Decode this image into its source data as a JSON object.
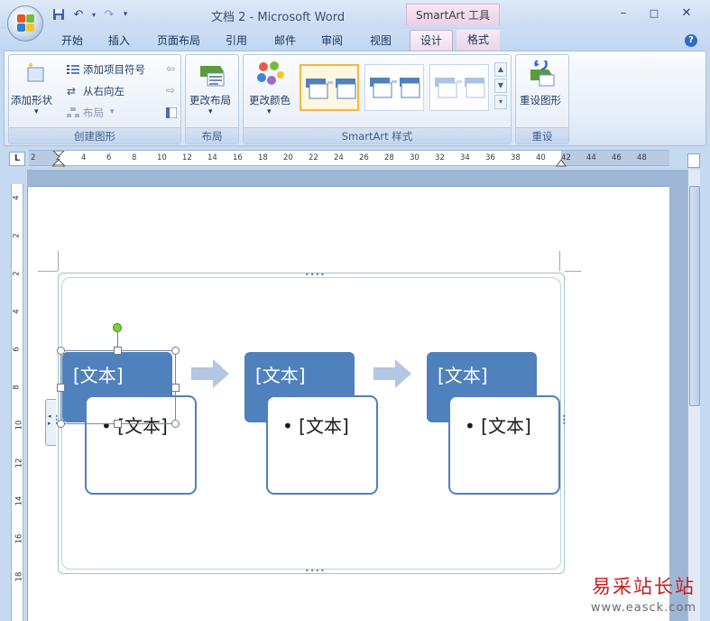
{
  "window": {
    "title": "文档 2 - Microsoft Word",
    "context_tools": "SmartArt 工具",
    "minimize": "–",
    "maximize": "□",
    "close": "✕"
  },
  "quick_access": {
    "save_icon": "save-icon",
    "undo_icon": "undo-icon",
    "redo_icon": "redo-icon",
    "customize_icon": "dropdown-icon"
  },
  "tabs": [
    "开始",
    "插入",
    "页面布局",
    "引用",
    "邮件",
    "审阅",
    "视图",
    "设计",
    "格式"
  ],
  "active_tab": "设计",
  "ribbon": {
    "create_graphic": {
      "label": "创建图形",
      "add_shape": "添加形状",
      "add_bullet": "添加项目符号",
      "right_to_left": "从右向左",
      "layout": "布局"
    },
    "layouts": {
      "label": "布局",
      "change_layout": "更改布局"
    },
    "smartart_styles": {
      "label": "SmartArt 样式",
      "change_colors": "更改颜色"
    },
    "reset": {
      "label": "重设",
      "reset_graphic": "重设图形"
    }
  },
  "ruler": {
    "corner": "L",
    "h_numbers": [
      "2",
      "2",
      "4",
      "6",
      "8",
      "10",
      "12",
      "14",
      "16",
      "18",
      "20",
      "22",
      "24",
      "26",
      "28",
      "30",
      "32",
      "34",
      "36",
      "38",
      "40",
      "42",
      "44",
      "46",
      "48"
    ],
    "v_numbers": [
      "4",
      "2",
      "2",
      "4",
      "6",
      "8",
      "10",
      "12",
      "14",
      "16",
      "18"
    ]
  },
  "smartart": {
    "nodes": [
      {
        "title": "[文本]",
        "bullet": "• [文本]"
      },
      {
        "title": "[文本]",
        "bullet": "• [文本]"
      },
      {
        "title": "[文本]",
        "bullet": "• [文本]"
      }
    ],
    "colors": {
      "accent": "#4f81bd",
      "arrow": "#b3c7e2",
      "rotate_handle": "#7ad13a"
    }
  },
  "watermark": {
    "title": "易采站长站",
    "url": "www.easck.com"
  }
}
